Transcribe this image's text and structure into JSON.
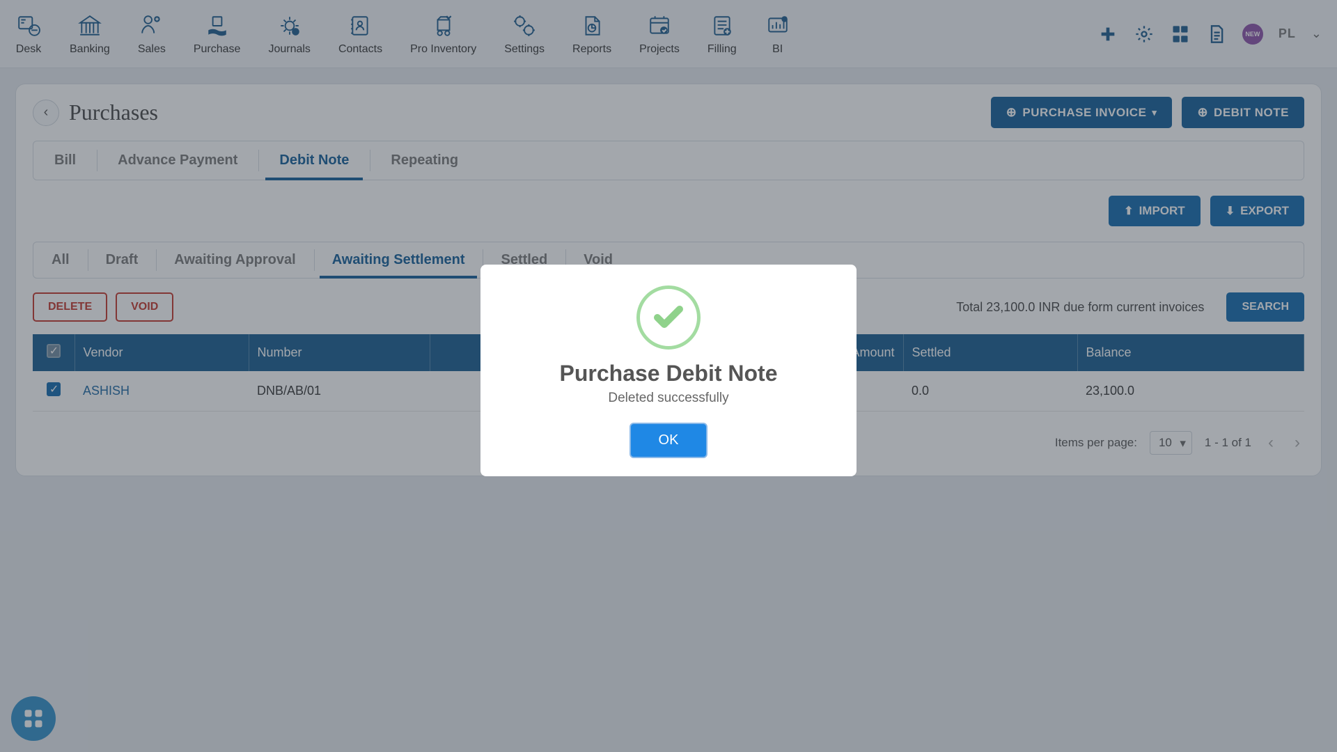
{
  "nav": [
    "Desk",
    "Banking",
    "Sales",
    "Purchase",
    "Journals",
    "Contacts",
    "Pro Inventory",
    "Settings",
    "Reports",
    "Projects",
    "Filling",
    "BI"
  ],
  "topright": {
    "new_badge": "NEW",
    "user": "PL"
  },
  "page": {
    "title": "Purchases",
    "purchase_invoice": "PURCHASE INVOICE",
    "debit_note": "DEBIT NOTE"
  },
  "tabs": [
    "Bill",
    "Advance Payment",
    "Debit Note",
    "Repeating"
  ],
  "active_tab": 2,
  "import": "IMPORT",
  "export": "EXPORT",
  "status_tabs": [
    "All",
    "Draft",
    "Awaiting Approval",
    "Awaiting Settlement",
    "Settled",
    "Void"
  ],
  "active_status": 3,
  "btn_delete": "DELETE",
  "btn_void": "VOID",
  "summary": "Total 23,100.0 INR due form current invoices",
  "btn_search": "SEARCH",
  "columns": [
    "Vendor",
    "Number",
    "",
    "",
    "Amount",
    "Settled",
    "Balance"
  ],
  "rows": [
    {
      "vendor": "ASHISH",
      "number": "DNB/AB/01",
      "c3": "",
      "c4": "",
      "amount": "",
      "settled": "0.0",
      "balance": "23,100.0"
    }
  ],
  "pager": {
    "label": "Items per page:",
    "per": "10",
    "range": "1 - 1 of 1"
  },
  "modal": {
    "title": "Purchase Debit Note",
    "msg": "Deleted successfully",
    "ok": "OK"
  }
}
